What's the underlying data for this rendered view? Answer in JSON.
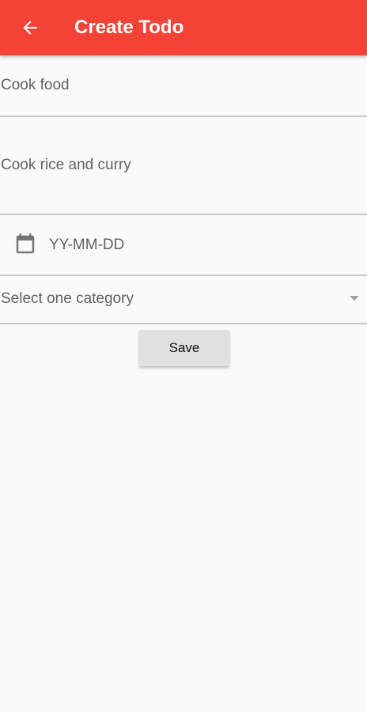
{
  "appbar": {
    "title": "Create Todo",
    "back_icon": "arrow-left-icon",
    "color": "#f44336"
  },
  "form": {
    "title_value": "Cook food",
    "description_value": "Cook rice and curry",
    "date_placeholder": "YY-MM-DD",
    "date_icon": "calendar-icon",
    "category_placeholder": "Select one category",
    "category_icon": "dropdown-arrow-icon",
    "save_label": "Save"
  }
}
